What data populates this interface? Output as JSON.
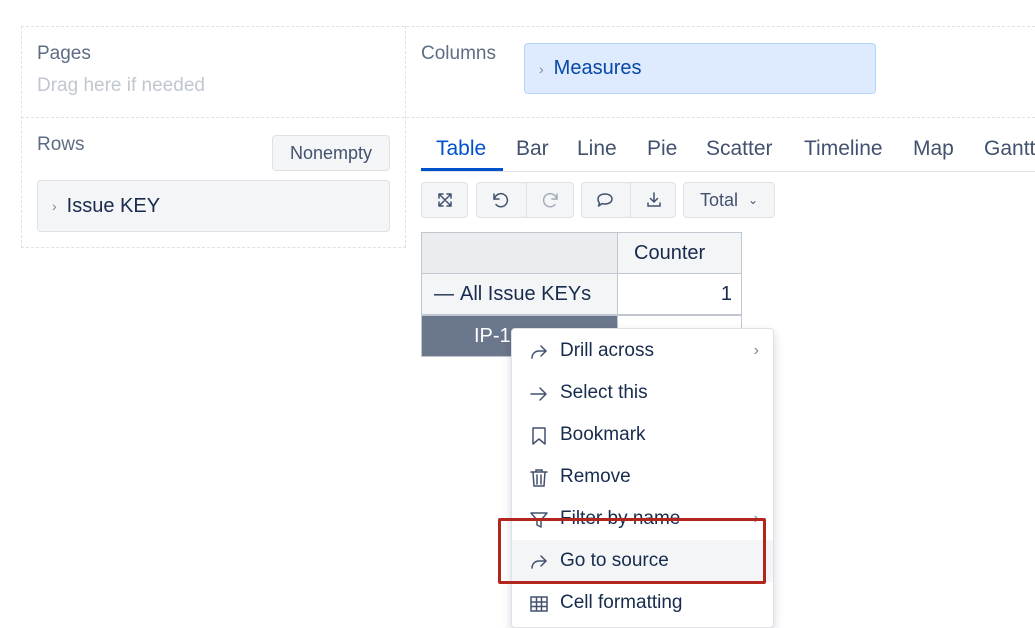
{
  "pages": {
    "label": "Pages",
    "placeholder": "Drag here if needed"
  },
  "columns": {
    "label": "Columns",
    "chip": "Measures"
  },
  "rows": {
    "label": "Rows",
    "nonempty_label": "Nonempty",
    "chip": "Issue KEY"
  },
  "tabs": [
    "Table",
    "Bar",
    "Line",
    "Pie",
    "Scatter",
    "Timeline",
    "Map",
    "Gantt"
  ],
  "active_tab": "Table",
  "toolbar": {
    "total_label": "Total"
  },
  "table": {
    "column_header": "Counter",
    "rows": [
      {
        "label": "All Issue KEYs",
        "value": "1"
      },
      {
        "label": "IP-1",
        "value": ""
      }
    ]
  },
  "context_menu": {
    "items": [
      {
        "label": "Drill across",
        "icon": "share-arrow-icon",
        "submenu": true
      },
      {
        "label": "Select this",
        "icon": "arrow-right-icon",
        "submenu": false
      },
      {
        "label": "Bookmark",
        "icon": "bookmark-icon",
        "submenu": false
      },
      {
        "label": "Remove",
        "icon": "trash-icon",
        "submenu": false
      },
      {
        "label": "Filter by name",
        "icon": "filter-icon",
        "submenu": true
      },
      {
        "label": "Go to source",
        "icon": "share-arrow-icon",
        "submenu": false,
        "highlighted": true
      },
      {
        "label": "Cell formatting",
        "icon": "table-grid-icon",
        "submenu": false
      }
    ]
  },
  "colors": {
    "accent": "#0052cc",
    "measures_bg": "#deebff",
    "selected_row_bg": "#6b778c",
    "annotation_border": "#b3261e"
  }
}
